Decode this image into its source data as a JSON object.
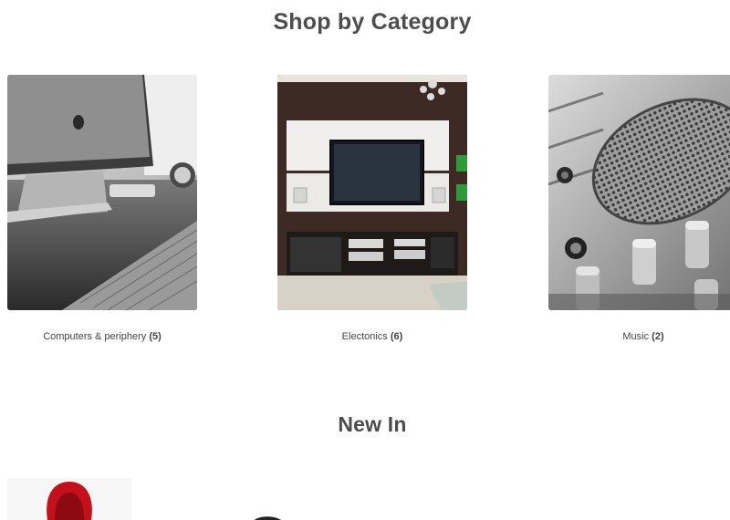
{
  "sections": {
    "shop_by_category": {
      "title": "Shop by Category"
    },
    "new_in": {
      "title": "New In"
    }
  },
  "categories": [
    {
      "name": "Computers & periphery",
      "count": "(5)",
      "image_icon": "computer-desk-photo"
    },
    {
      "name": "Electonics",
      "count": "(6)",
      "image_icon": "tv-living-room-photo"
    },
    {
      "name": "Music",
      "count": "(2)",
      "image_icon": "microphone-mixer-photo"
    }
  ],
  "new_in_items": [
    {
      "image_icon": "red-hoodie-photo"
    },
    {
      "image_icon": "headphones-photo"
    }
  ]
}
